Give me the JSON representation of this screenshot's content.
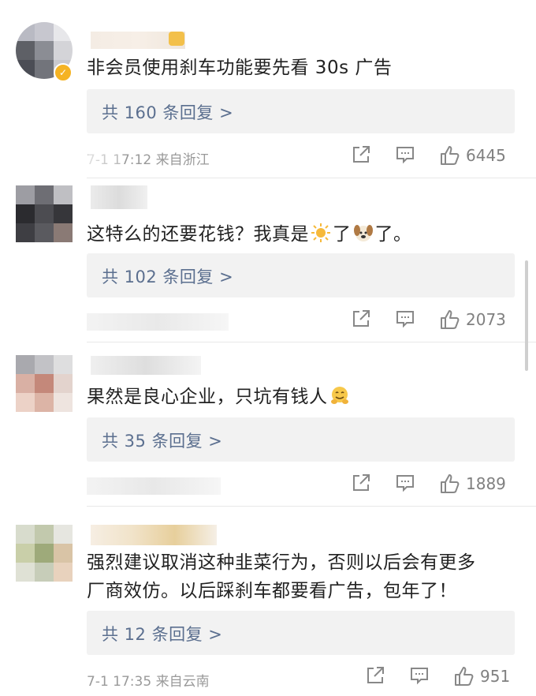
{
  "comments": [
    {
      "text": "非会员使用刹车功能要先看 30s 广告",
      "reply_label": "共 160 条回复 >",
      "meta": "7-1 17:12  来自浙江",
      "likes": "6445",
      "verified": true
    },
    {
      "text_a": "这特么的还要花钱？我真是",
      "text_b": "了",
      "text_c": "了。",
      "emoji_1": "sun-emoji",
      "emoji_2": "dog-emoji",
      "reply_label": "共 102 条回复 >",
      "likes": "2073"
    },
    {
      "text": "果然是良心企业，只坑有钱人",
      "emoji": "hugging-face-emoji",
      "reply_label": "共 35 条回复 >",
      "likes": "1889"
    },
    {
      "text_line1": "强烈建议取消这种韭菜行为，否则以后会有更多",
      "text_line2": "厂商效仿。以后踩刹车都要看广告，包年了！",
      "reply_label": "共 12 条回复 >",
      "meta": "7-1 17:35  来自云南",
      "likes": "951"
    }
  ],
  "icons": {
    "share": "share-icon",
    "comment": "comment-icon",
    "like": "thumbs-up-icon"
  },
  "colors": {
    "reply_text": "#5b6f8f",
    "reply_bg": "#f2f2f2",
    "meta_text": "#9a9a9a",
    "badge": "#f5b323"
  }
}
